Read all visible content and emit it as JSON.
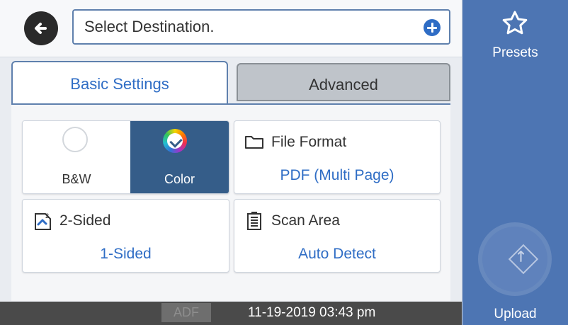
{
  "destination": {
    "placeholder": "Select Destination."
  },
  "tabs": [
    {
      "label": "Basic Settings",
      "selected": true
    },
    {
      "label": "Advanced",
      "selected": false
    }
  ],
  "color_mode": {
    "options": [
      {
        "label": "B&W",
        "selected": false
      },
      {
        "label": "Color",
        "selected": true
      }
    ]
  },
  "file_format": {
    "title": "File Format",
    "value": "PDF (Multi Page)"
  },
  "two_sided": {
    "title": "2-Sided",
    "value": "1-Sided"
  },
  "scan_area": {
    "title": "Scan Area",
    "value": "Auto Detect"
  },
  "status": {
    "adf": "ADF",
    "datetime": "11-19-2019 03:43 pm"
  },
  "side_actions": {
    "presets": "Presets",
    "upload": "Upload"
  },
  "colors": {
    "accent": "#2f6dc5",
    "panel": "#4d75b3",
    "selected_mode": "#355d89"
  },
  "icons": [
    "back-arrow-icon",
    "plus-icon",
    "color-check-icon",
    "folder-icon",
    "two-sided-icon",
    "scan-area-icon",
    "star-icon",
    "upload-diamond-icon"
  ]
}
